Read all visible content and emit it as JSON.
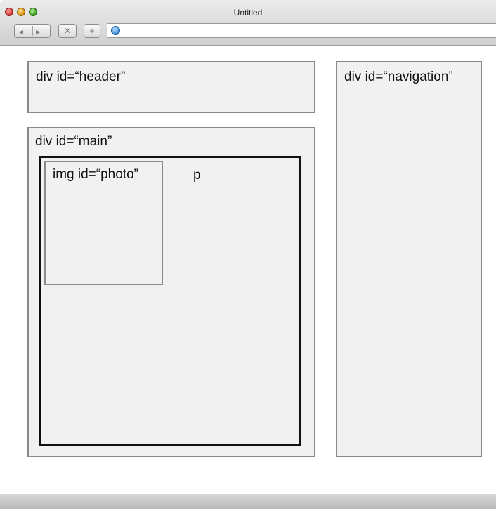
{
  "window": {
    "title": "Untitled"
  },
  "toolbar": {
    "back_forward_glyph": "◀ ▶",
    "stop_glyph": "✕",
    "add_glyph": "+",
    "address_value": "",
    "address_icon": "globe-icon"
  },
  "diagram": {
    "header_label": "div id=“header”",
    "navigation_label": "div id=“navigation”",
    "main_label": "div id=“main”",
    "photo_label": "img id=“photo”",
    "p_label": "p"
  }
}
